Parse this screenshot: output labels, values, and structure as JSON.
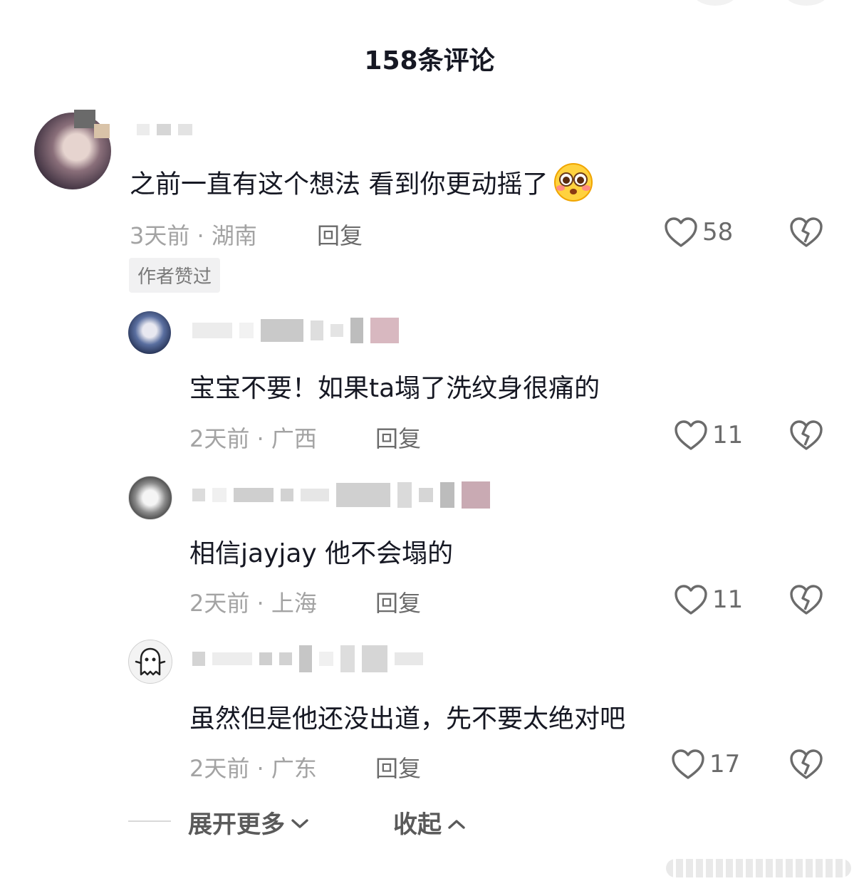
{
  "header": {
    "title": "158条评论"
  },
  "comments": [
    {
      "text": "之前一直有这个想法 看到你更动摇了",
      "emoji": "pleading-face-emoji",
      "time_location": "3天前 · 湖南",
      "reply_label": "回复",
      "likes": "58",
      "badge": "作者赞过"
    },
    {
      "text": "宝宝不要！如果ta塌了洗纹身很痛的",
      "time_location": "2天前 · 广西",
      "reply_label": "回复",
      "likes": "11"
    },
    {
      "text": "相信jayjay 他不会塌的",
      "time_location": "2天前 · 上海",
      "reply_label": "回复",
      "likes": "11"
    },
    {
      "text": "虽然但是他还没出道，先不要太绝对吧",
      "time_location": "2天前 · 广东",
      "reply_label": "回复",
      "likes": "17"
    }
  ],
  "footer": {
    "expand_label": "展开更多",
    "collapse_label": "收起"
  },
  "icons": {
    "like": "heart-outline-icon",
    "dislike": "broken-heart-icon",
    "expand": "chevron-down-icon",
    "collapse": "chevron-up-icon"
  },
  "colors": {
    "text": "#161823",
    "meta": "#a3a3a3",
    "icon": "#6b6b6b"
  }
}
